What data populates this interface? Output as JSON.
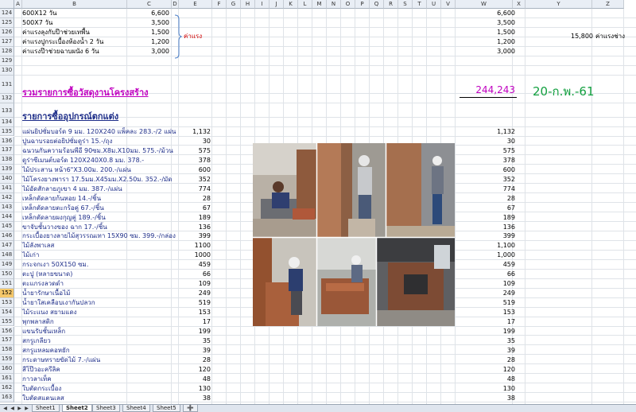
{
  "columns": [
    "A",
    "B",
    "C",
    "D",
    "E",
    "F",
    "G",
    "H",
    "I",
    "J",
    "K",
    "L",
    "M",
    "N",
    "O",
    "P",
    "Q",
    "R",
    "S",
    "T",
    "U",
    "V",
    "W",
    "X",
    "Y",
    "Z"
  ],
  "rows_top": [
    {
      "num": "124",
      "b": "600X12 วัน",
      "c": "6,600",
      "w": "6,600"
    },
    {
      "num": "125",
      "b": "500X7 วัน",
      "c": "3,500",
      "w": "3,500"
    },
    {
      "num": "126",
      "b": "ค่าแรงลุงกับป๊าช่วยเทพื้น",
      "c": "1,500",
      "w": "1,500"
    },
    {
      "num": "127",
      "b": "ค่าแรงปูกระเบื้องห้องน้ำ  2 วัน",
      "c": "1,200",
      "w": "1,200"
    },
    {
      "num": "128",
      "b": "ค่าแรงป๊าช่วยฉาบผนัง  6 วัน",
      "c": "3,000",
      "w": "3,000"
    },
    {
      "num": "129",
      "b": "",
      "c": "",
      "w": ""
    },
    {
      "num": "130",
      "b": "",
      "c": "",
      "w": ""
    }
  ],
  "labour_label": "ค่าแรง",
  "side_total": {
    "value": "15,800",
    "label": "ค่าแรงช่าง"
  },
  "row131": {
    "num": "131",
    "title": "รวมรายการซื้อวัสดุงานโครงสร้าง",
    "total": "244,243",
    "date": "20-ก.พ.-61"
  },
  "row132": {
    "num": "132"
  },
  "row133": {
    "num": "133",
    "title": "รายการซื้ออุปกรณ์ตกแต่ง"
  },
  "row134": {
    "num": "134"
  },
  "items": [
    {
      "num": "135",
      "b": "แผ่นยิปซั่มบอร์ด  9 มม. 120X240 แพ็คละ  283.-/2 แผ่น",
      "e": "1,132",
      "w": "1,132"
    },
    {
      "num": "136",
      "b": "ปูนฉาบรอยต่อยิปซั่มดูร่า  15.-/ถุง",
      "e": "30",
      "w": "30"
    },
    {
      "num": "137",
      "b": "ฉนวนกันความร้อนพีอี  90ซม.X8ม.X10มม. 575.-/ม้วน",
      "e": "575",
      "w": "575"
    },
    {
      "num": "138",
      "b": "ดูร่าซีเมนต์บอร์ด  120X240X0.8 มม. 378.-",
      "e": "378",
      "w": "378"
    },
    {
      "num": "139",
      "b": "ไม้ประสาน  หน้า6\"X3.00ม. 200.-/แผ่น",
      "e": "600",
      "w": "600"
    },
    {
      "num": "140",
      "b": "ไม้โครงยางพารา  17.5มม.X45มม.X2.50ม. 352.-/มัด",
      "e": "352",
      "w": "352"
    },
    {
      "num": "141",
      "b": "ไม้อัดสักลายภูเขา  4 มม. 387.-/แผ่น",
      "e": "774",
      "w": "774"
    },
    {
      "num": "142",
      "b": "เหล็กตัดลายก้นหอย  14.-/ชิ้น",
      "e": "28",
      "w": "28"
    },
    {
      "num": "143",
      "b": "เหล็กตัดลายตะกร้อคู่  67.-/ชิ้น",
      "e": "67",
      "w": "67"
    },
    {
      "num": "144",
      "b": "เหล็กตัดลายผงกุญคู่  189.-/ชิ้น",
      "e": "189",
      "w": "189"
    },
    {
      "num": "145",
      "b": "ขาจับชั้นวางของ  ฉาก  17.-/ชิ้น",
      "e": "136",
      "w": "136"
    },
    {
      "num": "146",
      "b": "กระเบื้องยางลายไม้สุวรรณเทา  15X90 ซม. 399.-/กล่อง",
      "e": "399",
      "w": "399"
    },
    {
      "num": "147",
      "b": "ไม้ลังพาเลส",
      "e": "1100",
      "w": "1,100"
    },
    {
      "num": "148",
      "b": "ไม้เก่า",
      "e": "1000",
      "w": "1,000"
    },
    {
      "num": "149",
      "b": "กระจกเงา  50X150 ซม.",
      "e": "459",
      "w": "459"
    },
    {
      "num": "150",
      "b": "ตะปู  (หลายขนาด)",
      "e": "66",
      "w": "66"
    },
    {
      "num": "151",
      "b": "ตะแกรงลวดดำ",
      "e": "109",
      "w": "109"
    },
    {
      "num": "152",
      "b": "น้ำยารักษาเนื้อไม้",
      "e": "249",
      "w": "249"
    },
    {
      "num": "153",
      "b": "น้ำยาใสเคลือบเงากันปลวก",
      "e": "519",
      "w": "519"
    },
    {
      "num": "154",
      "b": "ไม้ระแนง  สยามแดง",
      "e": "153",
      "w": "153"
    },
    {
      "num": "155",
      "b": "พุกพลาสติก",
      "e": "17",
      "w": "17"
    },
    {
      "num": "156",
      "b": "แขนรับชั้นเหล็ก",
      "e": "199",
      "w": "199"
    },
    {
      "num": "157",
      "b": "สกรูเกลียว",
      "e": "35",
      "w": "35"
    },
    {
      "num": "158",
      "b": "สกรูแหลมคอหยัก",
      "e": "39",
      "w": "39"
    },
    {
      "num": "159",
      "b": "กระดาษทรายขัดไม้  7.-/แผ่น",
      "e": "28",
      "w": "28"
    },
    {
      "num": "160",
      "b": "สีโป๊วอะครีลิค",
      "e": "120",
      "w": "120"
    },
    {
      "num": "161",
      "b": "กาวลาเท็ค",
      "e": "48",
      "w": "48"
    },
    {
      "num": "162",
      "b": "ใบตัดกระเบื้อง",
      "e": "130",
      "w": "130"
    },
    {
      "num": "163",
      "b": "ใบตัดสแตนเลส",
      "e": "38",
      "w": "38"
    }
  ],
  "selected_row": "152",
  "tabs": [
    "Sheet1",
    "Sheet2",
    "Sheet3",
    "Sheet4",
    "Sheet5"
  ],
  "active_tab": "Sheet2",
  "colors": {
    "magenta": "#c000c0",
    "navy": "#1f2f8a",
    "green": "#13a040",
    "red": "#d00000",
    "selected": "#f5c86b"
  }
}
